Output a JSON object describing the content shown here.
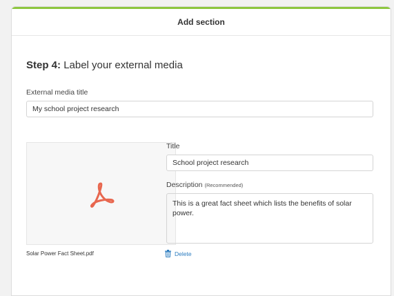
{
  "header": {
    "title": "Add section"
  },
  "step": {
    "prefix": "Step 4:",
    "text": "Label your external media"
  },
  "media_title": {
    "label": "External media title",
    "value": "My school project research"
  },
  "file": {
    "name": "Solar Power Fact Sheet.pdf",
    "icon": "pdf-icon",
    "icon_color": "#e8674f"
  },
  "title_field": {
    "label": "Title",
    "value": "School project research"
  },
  "description": {
    "label": "Description",
    "note": "(Recommended)",
    "value": "This is a great fact sheet which lists the benefits of solar power."
  },
  "delete": {
    "label": "Delete",
    "icon": "trash-icon",
    "color": "#2a7bbf"
  },
  "colors": {
    "accent": "#8dc63f"
  }
}
